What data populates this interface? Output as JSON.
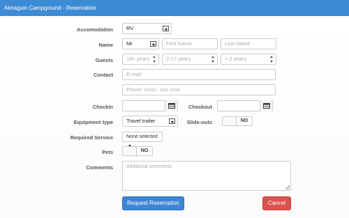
{
  "window": {
    "title": "Almaguin Campground - Reservation"
  },
  "labels": {
    "accommodation": "Accomodation",
    "name": "Name",
    "guests": "Guests",
    "contact": "Contact",
    "checkin": "Checkin",
    "checkout": "Checkout",
    "equipment_type": "Equipment type",
    "slide_outs": "Slide-outs",
    "required_service": "Required Service",
    "pets": "Pets",
    "comments": "Comments"
  },
  "fields": {
    "accommodation": {
      "value": "RV"
    },
    "title": {
      "value": "Mr"
    },
    "first_name": {
      "placeholder": "First Name"
    },
    "last_name": {
      "placeholder": "Last Name"
    },
    "adults": {
      "placeholder": "18+ years"
    },
    "children": {
      "placeholder": "2-17 years"
    },
    "infants": {
      "placeholder": "< 2 years"
    },
    "email": {
      "placeholder": "E-mail"
    },
    "phone": {
      "placeholder": "Phone: (xxx) - xxx xxxx"
    },
    "equipment_type": {
      "value": "Travel trailer"
    },
    "required_service": {
      "value": "None selected"
    },
    "comments": {
      "placeholder": "Additional comments"
    }
  },
  "toggles": {
    "slide_outs": {
      "state": "NO"
    },
    "pets": {
      "state": "NO"
    }
  },
  "buttons": {
    "submit": "Request Reservation",
    "cancel": "Cancel"
  },
  "colors": {
    "titlebar": "#3d8bd4",
    "primary": "#3e86d4",
    "danger": "#d9534f"
  },
  "icons": {
    "calendar": "calendar-icon",
    "dropdown": "chevron-down-icon"
  }
}
